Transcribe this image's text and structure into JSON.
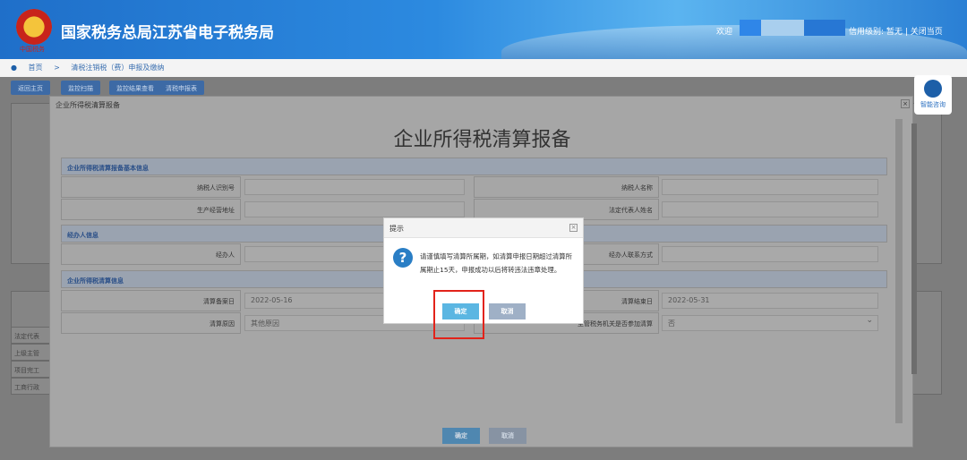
{
  "header": {
    "title": "国家税务总局江苏省电子税务局",
    "emblem_text": "中国税务",
    "welcome": "欢迎",
    "credit_label": "信用级别:",
    "credit_value": "暂无",
    "separator": "|",
    "close": "关闭当页"
  },
  "breadcrumb": {
    "home": "首页",
    "sep": ">",
    "current": "清税注销税（费）申报及缴纳"
  },
  "tabs": [
    "返回主页",
    "监控扫描",
    "监控结果查看",
    "清税申报表"
  ],
  "background_rows": [
    "法定代表",
    "上级主管",
    "项目完工",
    "工商行政"
  ],
  "help": {
    "label": "智能咨询"
  },
  "window": {
    "title": "企业所得税清算报备",
    "close": "×",
    "form_title": "企业所得税清算报备",
    "sections": [
      "企业所得税清算报备基本信息",
      "经办人信息",
      "企业所得税清算信息"
    ],
    "fields": {
      "taxpayer_id": "纳税人识别号",
      "taxpayer_name": "纳税人名称",
      "address": "生产经营地址",
      "legal_rep": "法定代表人姓名",
      "agent": "经办人",
      "agent_contact": "经办人联系方式",
      "start_date_label": "清算备案日",
      "start_date": "2022-05-16",
      "end_date_label": "清算结束日",
      "end_date": "2022-05-31",
      "reason_label": "清算原因",
      "reason": "其他原因",
      "tax_org_label": "主管税务机关是否参加清算",
      "tax_org": "否"
    },
    "ok": "确定",
    "cancel": "取消"
  },
  "dialog": {
    "title": "提示",
    "close": "×",
    "icon": "question-icon",
    "message": "请谨慎填写清算所属期，如清算申报日期超过清算所属期止15天，申报成功以后将转违法违章处理。",
    "ok": "确定",
    "cancel": "取消"
  }
}
